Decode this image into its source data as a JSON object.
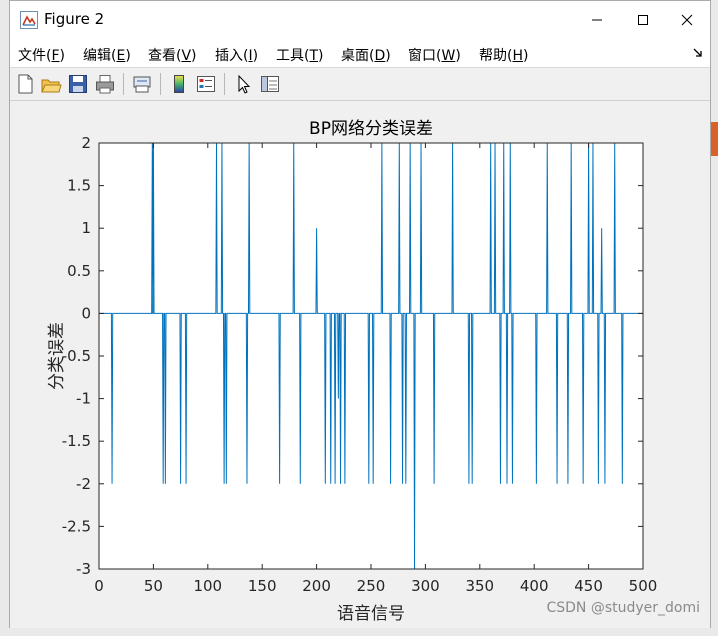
{
  "window": {
    "title": "Figure 2"
  },
  "menu": [
    {
      "label": "文件(",
      "key": "F",
      "end": ")"
    },
    {
      "label": "编辑(",
      "key": "E",
      "end": ")"
    },
    {
      "label": "查看(",
      "key": "V",
      "end": ")"
    },
    {
      "label": "插入(",
      "key": "I",
      "end": ")"
    },
    {
      "label": "工具(",
      "key": "T",
      "end": ")"
    },
    {
      "label": "桌面(",
      "key": "D",
      "end": ")"
    },
    {
      "label": "窗口(",
      "key": "W",
      "end": ")"
    },
    {
      "label": "帮助(",
      "key": "H",
      "end": ")"
    }
  ],
  "toolbar": {
    "icons": [
      "new-figure-icon",
      "open-file-icon",
      "save-icon",
      "print-icon",
      "print-preview-icon",
      "colorbar-icon",
      "legend-icon",
      "pointer-icon",
      "property-inspector-icon"
    ]
  },
  "colors": {
    "line": "#0072bd",
    "axes": "#262626",
    "window_bg": "#f0f0f0"
  },
  "watermark": "CSDN @studyer_domi",
  "chart_data": {
    "type": "line",
    "title": "BP网络分类误差",
    "xlabel": "语音信号",
    "ylabel": "分类误差",
    "xlim": [
      0,
      500
    ],
    "ylim": [
      -3,
      2
    ],
    "xticks": [
      "0",
      "50",
      "100",
      "150",
      "200",
      "250",
      "300",
      "350",
      "400",
      "450",
      "500"
    ],
    "yticks": [
      "2",
      "1.5",
      "1",
      "0.5",
      "0",
      "-0.5",
      "-1",
      "-1.5",
      "-2",
      "-2.5",
      "-3"
    ],
    "grid": false,
    "spikes": [
      {
        "x": 12,
        "y": -2
      },
      {
        "x": 49,
        "y": 2
      },
      {
        "x": 50,
        "y": 2
      },
      {
        "x": 59,
        "y": -2
      },
      {
        "x": 61,
        "y": -2
      },
      {
        "x": 75,
        "y": -2
      },
      {
        "x": 80,
        "y": -2
      },
      {
        "x": 108,
        "y": 2
      },
      {
        "x": 113,
        "y": 2
      },
      {
        "x": 115,
        "y": -2
      },
      {
        "x": 117,
        "y": -2
      },
      {
        "x": 136,
        "y": -2
      },
      {
        "x": 138,
        "y": 2
      },
      {
        "x": 166,
        "y": -2
      },
      {
        "x": 179,
        "y": 2
      },
      {
        "x": 185,
        "y": -2
      },
      {
        "x": 200,
        "y": 1
      },
      {
        "x": 208,
        "y": -2
      },
      {
        "x": 213,
        "y": -2
      },
      {
        "x": 217,
        "y": -2
      },
      {
        "x": 220,
        "y": -1
      },
      {
        "x": 222,
        "y": -2
      },
      {
        "x": 226,
        "y": -2
      },
      {
        "x": 248,
        "y": -2
      },
      {
        "x": 252,
        "y": -2
      },
      {
        "x": 260,
        "y": 2
      },
      {
        "x": 268,
        "y": -2
      },
      {
        "x": 276,
        "y": 2
      },
      {
        "x": 279,
        "y": -2
      },
      {
        "x": 282,
        "y": -2
      },
      {
        "x": 286,
        "y": 2
      },
      {
        "x": 290,
        "y": -3
      },
      {
        "x": 296,
        "y": 2
      },
      {
        "x": 308,
        "y": -2
      },
      {
        "x": 325,
        "y": 2
      },
      {
        "x": 340,
        "y": -2
      },
      {
        "x": 343,
        "y": -2
      },
      {
        "x": 360,
        "y": 2
      },
      {
        "x": 364,
        "y": 2
      },
      {
        "x": 369,
        "y": -2
      },
      {
        "x": 372,
        "y": 2
      },
      {
        "x": 375,
        "y": -2
      },
      {
        "x": 378,
        "y": 2
      },
      {
        "x": 380,
        "y": -2
      },
      {
        "x": 402,
        "y": -2
      },
      {
        "x": 412,
        "y": 2
      },
      {
        "x": 421,
        "y": -2
      },
      {
        "x": 431,
        "y": -2
      },
      {
        "x": 434,
        "y": 2
      },
      {
        "x": 445,
        "y": -2
      },
      {
        "x": 450,
        "y": 2
      },
      {
        "x": 454,
        "y": 2
      },
      {
        "x": 459,
        "y": -2
      },
      {
        "x": 462,
        "y": 1
      },
      {
        "x": 465,
        "y": -2
      },
      {
        "x": 474,
        "y": 2
      },
      {
        "x": 481,
        "y": -2
      }
    ]
  }
}
